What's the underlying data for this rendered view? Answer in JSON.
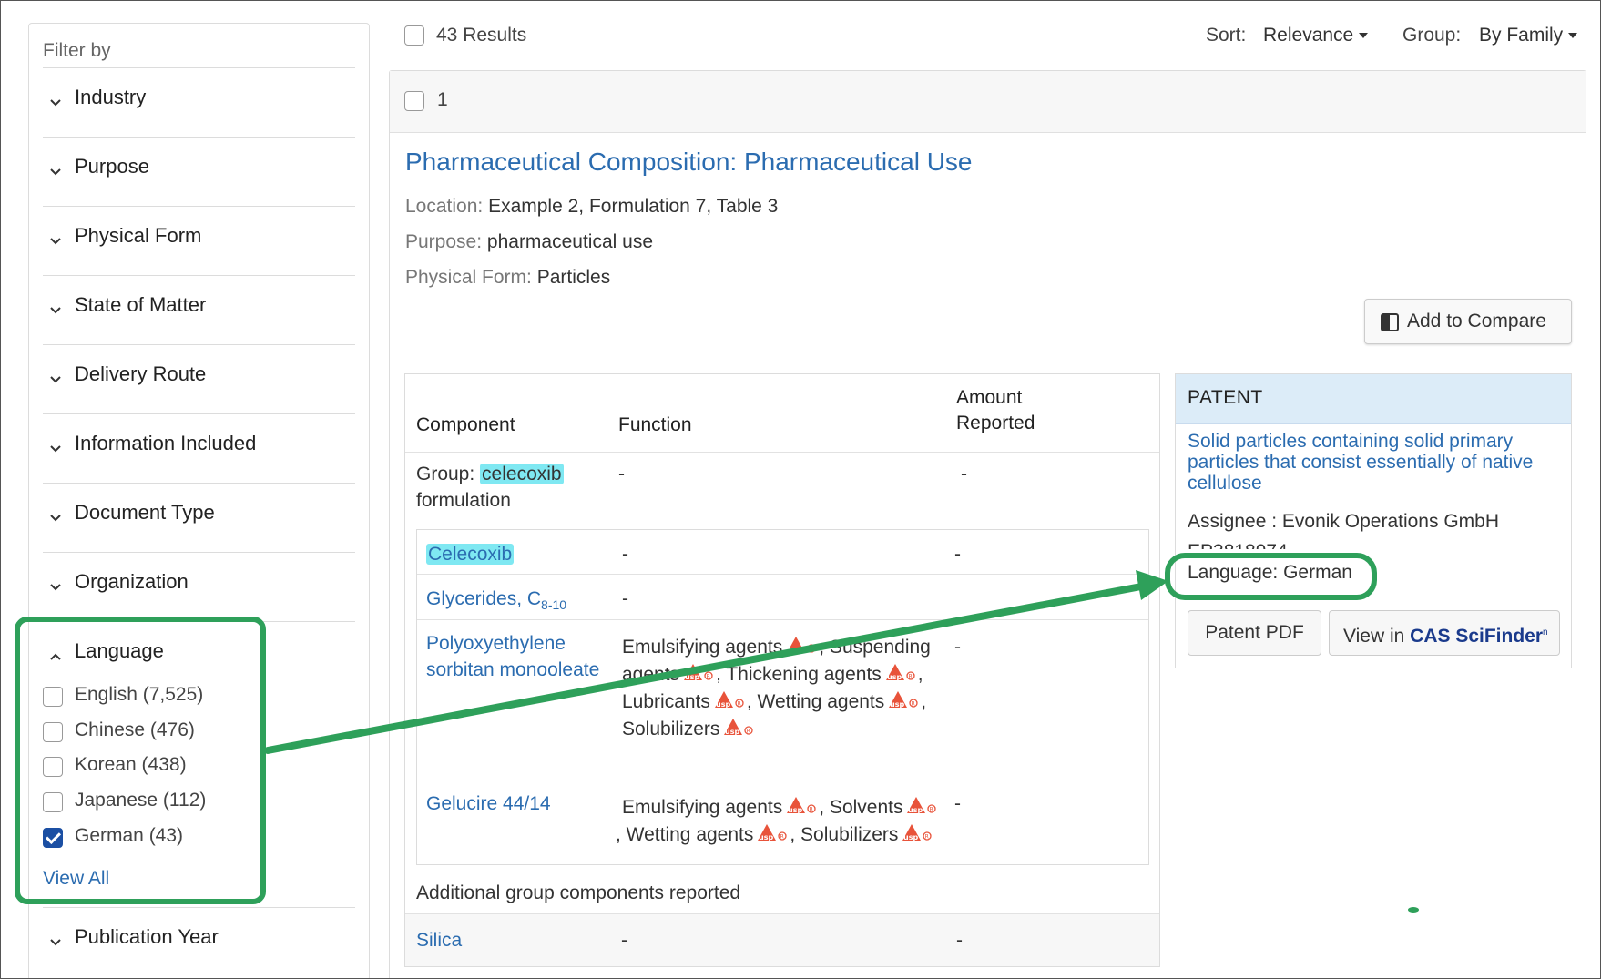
{
  "sidebar": {
    "heading": "Filter by",
    "facets": [
      {
        "label": "Industry"
      },
      {
        "label": "Purpose"
      },
      {
        "label": "Physical Form"
      },
      {
        "label": "State of Matter"
      },
      {
        "label": "Delivery Route"
      },
      {
        "label": "Information Included"
      },
      {
        "label": "Document Type"
      },
      {
        "label": "Organization"
      }
    ],
    "language": {
      "label": "Language",
      "options": [
        {
          "label": "English (7,525)",
          "checked": false
        },
        {
          "label": "Chinese (476)",
          "checked": false
        },
        {
          "label": "Korean (438)",
          "checked": false
        },
        {
          "label": "Japanese (112)",
          "checked": false
        },
        {
          "label": "German (43)",
          "checked": true
        }
      ],
      "view_all": "View All"
    },
    "publication_year": {
      "label": "Publication Year"
    }
  },
  "topbar": {
    "results": "43 Results",
    "sort_label": "Sort:",
    "sort_value": "Relevance",
    "group_label": "Group:",
    "group_value": "By Family"
  },
  "result": {
    "index": "1",
    "title": "Pharmaceutical Composition: Pharmaceutical Use",
    "location_label": "Location:",
    "location_value": "Example 2, Formulation 7, Table 3",
    "purpose_label": "Purpose:",
    "purpose_value": "pharmaceutical use",
    "form_label": "Physical Form:",
    "form_value": "Particles",
    "compare_label": "Add to Compare",
    "table": {
      "headers": {
        "component": "Component",
        "function": "Function",
        "amount_line1": "Amount",
        "amount_line2": "Reported"
      },
      "group": {
        "prefix": "Group:",
        "name": "celecoxib",
        "suffix": "formulation",
        "function": "-",
        "amount": "-"
      },
      "rows": [
        {
          "component": "Celecoxib",
          "function": "-",
          "amount": "-"
        },
        {
          "component": "Glycerides, C",
          "subscript": "8-10",
          "function": "-"
        },
        {
          "component_line1": "Polyoxyethylene",
          "component_line2": "sorbitan monooleate",
          "function_parts": [
            "Emulsifying agents",
            ", Suspending",
            "agents",
            ", Thickening agents",
            ",",
            "Lubricants",
            ", Wetting agents",
            ",",
            "Solubilizers"
          ],
          "amount": "-"
        },
        {
          "component": "Gelucire 44/14",
          "function_parts": [
            "Emulsifying agents",
            ", Solvents",
            ", Wetting agents",
            ", Solubilizers"
          ],
          "amount": "-"
        }
      ],
      "additional_label": "Additional group components reported",
      "extra_row": {
        "component": "Silica",
        "function": "-",
        "amount": "-"
      }
    },
    "patent": {
      "header": "PATENT",
      "title": "Solid particles containing solid primary particles that consist essentially of native cellulose",
      "assignee": "Assignee : Evonik Operations GmbH",
      "number": "EP3818974",
      "language": "Language: German",
      "pdf_label": "Patent PDF",
      "scifinder_prefix": "View in ",
      "scifinder_brand": "CAS SciFinder",
      "scifinder_sup": "n"
    }
  },
  "icons": {
    "usp": "usp-logo-icon",
    "chevron": "chevron-down-icon",
    "compare": "compare-icon"
  },
  "colors": {
    "link": "#2b6cb0",
    "highlight": "#7fe8f2",
    "annotation": "#2ea05a",
    "usp": "#e8533a",
    "patent_header": "#dcecf8"
  }
}
